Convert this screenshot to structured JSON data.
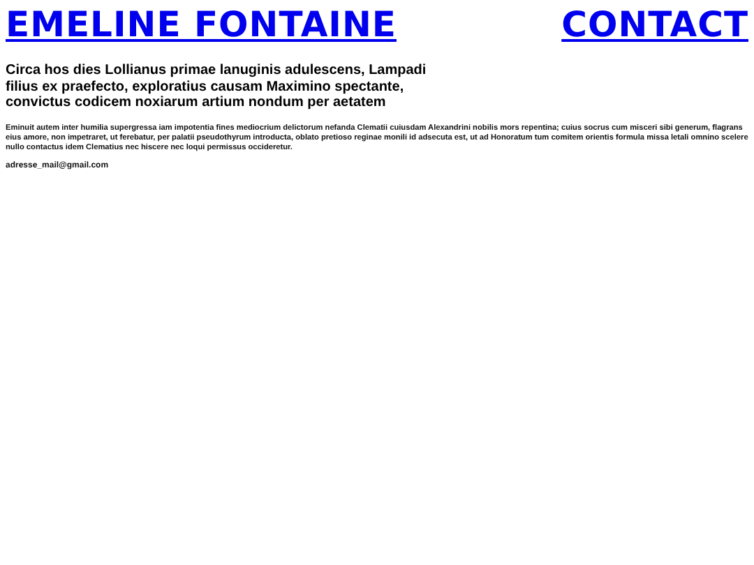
{
  "header": {
    "name": "EMELINE FONTAINE",
    "contact_link": "CONTACT"
  },
  "intro": "Circa hos dies Lollianus primae lanuginis adulescens, Lampadi filius ex praefecto, exploratius causam Maximino spectante, convictus codicem noxiarum artium nondum per aetatem",
  "body": "Eminuit autem inter humilia supergressa iam impotentia fines mediocrium delictorum nefanda Clematii cuiusdam Alexandrini nobilis mors repentina; cuius socrus cum misceri sibi generum, flagrans eius amore, non impetraret, ut ferebatur, per palatii pseudothyrum introducta, oblato pretioso reginae monili id adsecuta est, ut ad Honoratum tum comitem orientis formula missa letali omnino scelere nullo contactus idem Clematius nec hiscere nec loqui permissus occideretur.",
  "email": "adresse_mail@gmail.com"
}
